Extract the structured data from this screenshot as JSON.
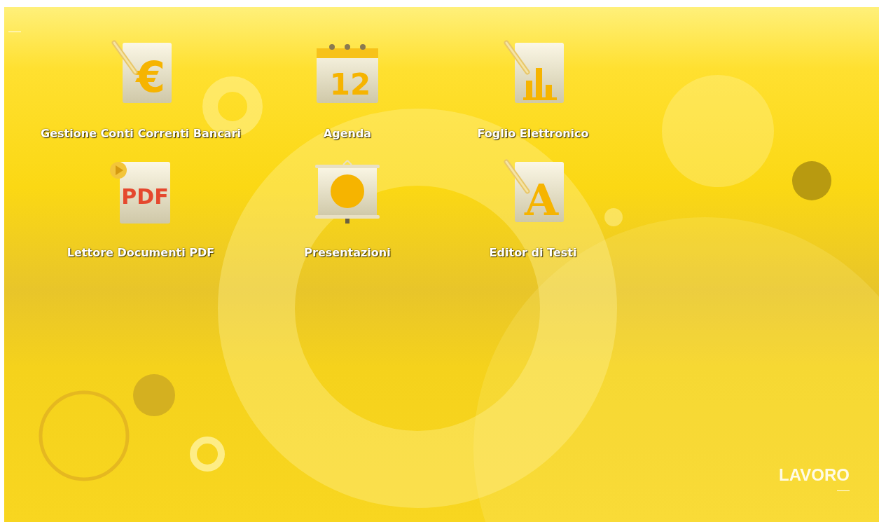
{
  "apps": [
    {
      "kind": "finance",
      "label": "Gestione Conti Correnti Bancari",
      "icon_text": "€"
    },
    {
      "kind": "calendar",
      "label": "Agenda",
      "icon_text": "12"
    },
    {
      "kind": "spreadsheet",
      "label": "Foglio Elettronico"
    },
    {
      "kind": "pdf",
      "label": "Lettore Documenti PDF",
      "icon_text": "PDF"
    },
    {
      "kind": "presentation",
      "label": "Presentazioni"
    },
    {
      "kind": "text",
      "label": "Editor di Testi",
      "icon_text": "A"
    }
  ],
  "workspace": {
    "title": "LAVORO"
  }
}
